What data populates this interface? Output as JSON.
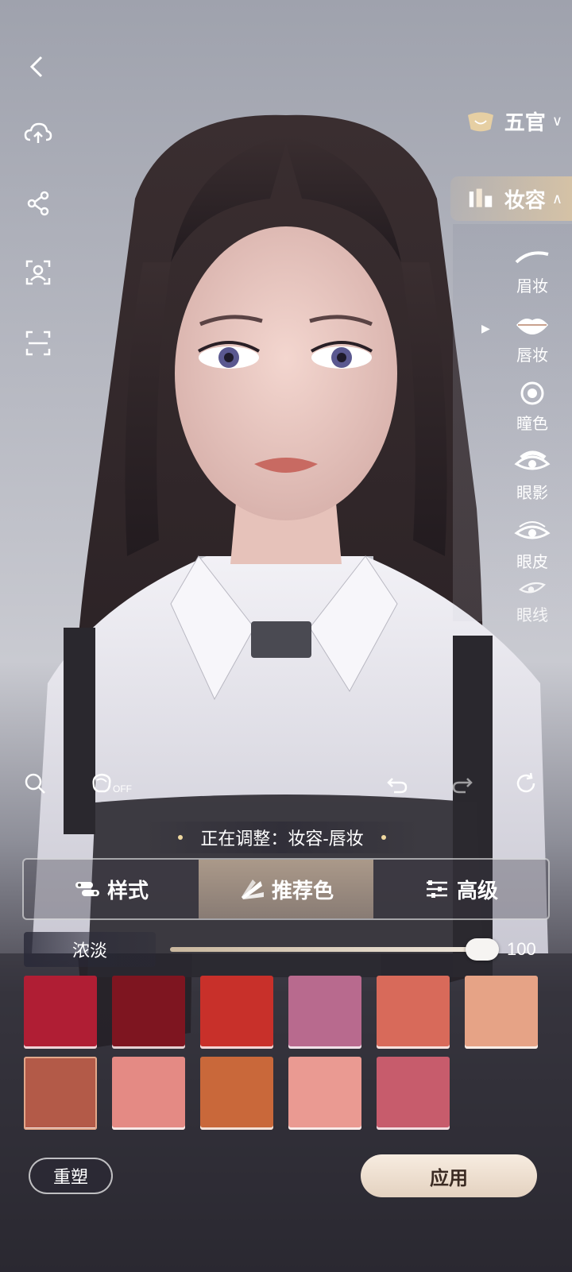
{
  "colors": {
    "accent_gold": "#d9c2a0",
    "apply_bg": "#f2e4d6"
  },
  "left_toolbar": [
    {
      "name": "back-icon"
    },
    {
      "name": "cloud-upload-icon"
    },
    {
      "name": "share-icon"
    },
    {
      "name": "face-scan-icon"
    },
    {
      "name": "scan-frame-icon"
    }
  ],
  "categories": {
    "facial": {
      "label": "五官",
      "chevron": "∨"
    },
    "makeup": {
      "label": "妆容",
      "chevron": "∧"
    }
  },
  "makeup_items": [
    {
      "label": "眉妆",
      "icon": "eyebrow-icon"
    },
    {
      "label": "唇妆",
      "icon": "lips-icon",
      "selected": true
    },
    {
      "label": "瞳色",
      "icon": "pupil-icon"
    },
    {
      "label": "眼影",
      "icon": "eyeshadow-icon"
    },
    {
      "label": "眼皮",
      "icon": "eyelid-icon"
    },
    {
      "label": "眼线",
      "icon": "eyeliner-icon"
    }
  ],
  "tools": {
    "off_label": "OFF"
  },
  "status_text": "正在调整：妆容-唇妆",
  "tabs": [
    {
      "label": "样式",
      "icon": "style-icon"
    },
    {
      "label": "推荐色",
      "icon": "palette-icon",
      "active": true
    },
    {
      "label": "高级",
      "icon": "sliders-icon"
    }
  ],
  "intensity": {
    "label": "浓淡",
    "value": "100",
    "fraction": 1.0
  },
  "swatches": [
    "#b01e34",
    "#7e1520",
    "#c8302a",
    "#b86a8e",
    "#d86a5a",
    "#e6a386",
    "#b35a48",
    "#e48a84",
    "#c9683a",
    "#ea9a92",
    "#c75c6c"
  ],
  "selected_swatch": 6,
  "buttons": {
    "reset": "重塑",
    "apply": "应用"
  }
}
